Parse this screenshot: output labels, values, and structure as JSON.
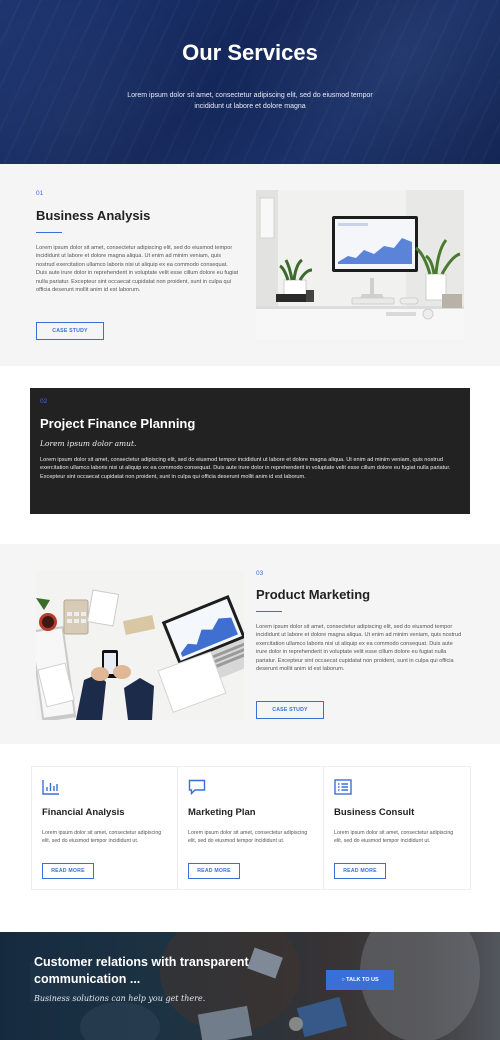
{
  "hero": {
    "title": "Our Services",
    "subtitle": "Lorem ipsum dolor sit amet, consectetur adipiscing elit, sed do eiusmod tempor incididunt ut labore et dolore magna"
  },
  "services": [
    {
      "number": "01",
      "title": "Business Analysis",
      "body": "Lorem ipsum dolor sit amet, consectetur adipiscing elit, sed do eiusmod tempor incididunt ut labore et dolore magna aliqua. Ut enim ad minim veniam, quis nostrud exercitation ullamco laboris nisi ut aliquip ex ea commodo consequat. Duis aute irure dolor in reprehenderit in voluptate velit esse cillum dolore eu fugiat nulla pariatur. Excepteur sint occaecat cupidatat non proident, sunt in culpa qui officia deserunt mollit anim id est laborum.",
      "button": "CASE STUDY"
    },
    {
      "number": "02",
      "title": "Project Finance Planning",
      "tagline": "Lorem ipsum dolor amut.",
      "body": "Lorem ipsum dolor sit amet, consectetur adipiscing elit, sed do eiusmod tempor incididunt ut labore et dolore magna aliqua. Ut enim ad minim veniam, quis nostrud exercitation ullamco laboris nisi ut aliquip ex ea commodo consequat. Duis aute irure dolor in reprehenderit in voluptate velit esse cillum dolore eu fugiat nulla pariatur. Excepteur sint occaecat cupidatat non proident, sunt in culpa qui officia deserunt mollit anim id est laborum."
    },
    {
      "number": "03",
      "title": "Product Marketing",
      "body": "Lorem ipsum dolor sit amet, consectetur adipiscing elit, sed do eiusmod tempor incididunt ut labore et dolore magna aliqua. Ut enim ad minim veniam, quis nostrud exercitation ullamco laboris nisi ut aliquip ex ea commodo consequat. Duis aute irure dolor in reprehenderit in voluptate velit esse cillum dolore eu fugiat nulla pariatur. Excepteur sint occaecat cupidatat non proident, sunt in culpa qui officia deserunt mollit anim id est laborum.",
      "button": "CASE STUDY"
    }
  ],
  "cards": [
    {
      "icon": "bar-chart-icon",
      "title": "Financial Analysis",
      "body": "Lorem ipsum dolor sit amet, consectetur adipiscing elit, sed do eiusmod tempor incididunt ut.",
      "button": "READ MORE"
    },
    {
      "icon": "chat-bubble-icon",
      "title": "Marketing Plan",
      "body": "Lorem ipsum dolor sit amet, consectetur adipiscing elit, sed do eiusmod tempor incididunt ut.",
      "button": "READ MORE"
    },
    {
      "icon": "list-icon",
      "title": "Business Consult",
      "body": "Lorem ipsum dolor sit amet, consectetur adipiscing elit, sed do eiusmod tempor incididunt ut.",
      "button": "READ MORE"
    }
  ],
  "cta": {
    "title": "Customer relations with transparent communication ...",
    "subtitle": "Business solutions can help you get there.",
    "button": "TALK TO US"
  },
  "colors": {
    "accent": "#3b6fd8",
    "hero": "#1a3066",
    "dark_box": "#222222"
  }
}
